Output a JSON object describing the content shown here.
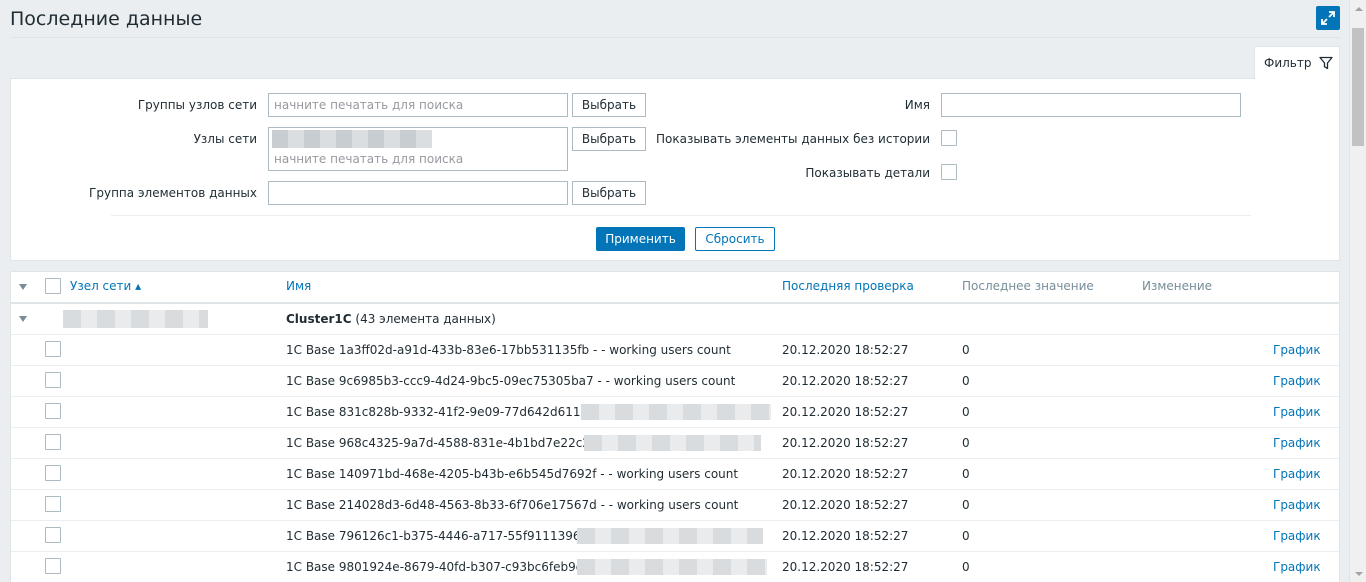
{
  "page": {
    "title": "Последние данные"
  },
  "filter": {
    "tab_label": "Фильтр",
    "host_groups_label": "Группы узлов сети",
    "hosts_label": "Узлы сети",
    "app_label": "Группа элементов данных",
    "search_placeholder": "начните печатать для поиска",
    "select_label": "Выбрать",
    "name_label": "Имя",
    "name_value": "",
    "show_without_history_label": "Показывать элементы данных без истории",
    "show_details_label": "Показывать детали",
    "apply_label": "Применить",
    "reset_label": "Сбросить"
  },
  "table": {
    "columns": {
      "host": "Узел сети ▴",
      "name": "Имя",
      "last_check": "Последняя проверка",
      "last_value": "Последнее значение",
      "change": "Изменение"
    },
    "group": {
      "name": "Cluster1C",
      "count_text": "(43 элемента данных)"
    },
    "graph_label": "График",
    "rows": [
      {
        "name": "1C Base 1a3ff02d-a91d-433b-83e6-17bb531135fb - - working users count",
        "last_check": "20.12.2020 18:52:27",
        "last_value": "0",
        "redacted": false
      },
      {
        "name": "1C Base 9c6985b3-ccc9-4d24-9bc5-09ec75305ba7 - - working users count",
        "last_check": "20.12.2020 18:52:27",
        "last_value": "0",
        "redacted": false
      },
      {
        "name": "1C Base 831c828b-9332-41f2-9e09-77d642d611e5 -",
        "last_check": "20.12.2020 18:52:27",
        "last_value": "0",
        "redacted": true
      },
      {
        "name": "1C Base 968c4325-9a7d-4588-831e-4b1bd7e22c22 -",
        "last_check": "20.12.2020 18:52:27",
        "last_value": "0",
        "redacted": true
      },
      {
        "name": "1C Base 140971bd-468e-4205-b43b-e6b545d7692f - - working users count",
        "last_check": "20.12.2020 18:52:27",
        "last_value": "0",
        "redacted": false
      },
      {
        "name": "1C Base 214028d3-6d48-4563-8b33-6f706e17567d - - working users count",
        "last_check": "20.12.2020 18:52:27",
        "last_value": "0",
        "redacted": false
      },
      {
        "name": "1C Base 796126c1-b375-4446-a717-55f91113967f -",
        "last_check": "20.12.2020 18:52:27",
        "last_value": "0",
        "redacted": true
      },
      {
        "name": "1C Base 9801924e-8679-40fd-b307-c93bc6feb9da -",
        "last_check": "20.12.2020 18:52:27",
        "last_value": "0",
        "redacted": true
      }
    ]
  },
  "icons": {
    "fullscreen": "fullscreen-icon",
    "filter": "filter-icon",
    "collapse": "triangle-down-icon"
  },
  "colors": {
    "accent": "#0275b8",
    "background": "#ebeef0",
    "text": "#1f2c33",
    "muted": "#768d99"
  }
}
